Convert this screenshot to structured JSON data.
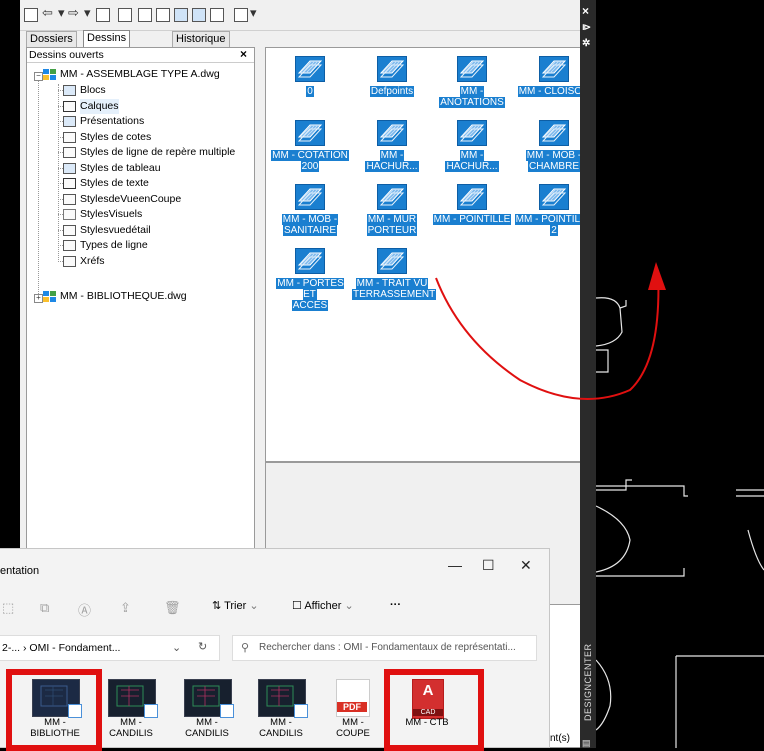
{
  "design_center": {
    "tabs": [
      "Dossiers",
      "Dessins ouverts",
      "Historique"
    ],
    "active_tab": "Dessins ouverts",
    "tree": {
      "header": "Dessins ouverts",
      "drawing1": "MM - ASSEMBLAGE TYPE A.dwg",
      "children": [
        {
          "label": "Blocs",
          "icon": "blocks-icon"
        },
        {
          "label": "Calques",
          "icon": "layers-icon"
        },
        {
          "label": "Présentations",
          "icon": "layouts-icon"
        },
        {
          "label": "Styles de cotes",
          "icon": "dimstyle-icon"
        },
        {
          "label": "Styles de ligne de repère multiple",
          "icon": "mleader-icon"
        },
        {
          "label": "Styles de tableau",
          "icon": "tablestyle-icon"
        },
        {
          "label": "Styles de texte",
          "icon": "textstyle-icon"
        },
        {
          "label": "StylesdeVueenCoupe",
          "icon": "sectionview-icon"
        },
        {
          "label": "StylesVisuels",
          "icon": "visualstyle-icon"
        },
        {
          "label": "Stylesvuedétail",
          "icon": "detailview-icon"
        },
        {
          "label": "Types de ligne",
          "icon": "linetype-icon"
        },
        {
          "label": "Xréfs",
          "icon": "xref-icon"
        }
      ],
      "drawing2": "MM - BIBLIOTHEQUE.dwg"
    },
    "layers": [
      {
        "l1": "0",
        "l2": ""
      },
      {
        "l1": "Defpoints",
        "l2": ""
      },
      {
        "l1": "MM -",
        "l2": "ANOTATIONS"
      },
      {
        "l1": "MM - CLOISON",
        "l2": ""
      },
      {
        "l1": "MM - COTATION",
        "l2": "200"
      },
      {
        "l1": "MM -",
        "l2": "HACHUR..."
      },
      {
        "l1": "MM -",
        "l2": "HACHUR..."
      },
      {
        "l1": "MM - MOB -",
        "l2": "CHAMBRE"
      },
      {
        "l1": "MM - MOB -",
        "l2": "SANITAIRE"
      },
      {
        "l1": "MM - MUR",
        "l2": "PORTEUR"
      },
      {
        "l1": "MM - POINTILLE",
        "l2": ""
      },
      {
        "l1": "MM - POINTILLE",
        "l2": "2"
      },
      {
        "l1": "MM - PORTES ET",
        "l2": "ACCES"
      },
      {
        "l1": "MM - TRAIT VU",
        "l2": "TERRASSEMENT"
      }
    ],
    "sidebar_label": "DESIGNCENTER",
    "desc_fragment": "nt(s)",
    "close_x": "×"
  },
  "explorer": {
    "title": "entation",
    "toolbar": {
      "sort": "Trier",
      "view": "Afficher",
      "more": "···"
    },
    "breadcrumb": "2-... › OMI - Fondament...",
    "search_placeholder": "Rechercher dans : OMI - Fondamentaux de représentati...",
    "files": [
      {
        "l1": "MM -",
        "l2": "BIBLIOTHE"
      },
      {
        "l1": "MM -",
        "l2": "CANDILIS"
      },
      {
        "l1": "MM -",
        "l2": "CANDILIS"
      },
      {
        "l1": "MM -",
        "l2": "CANDILIS"
      },
      {
        "l1": "MM -",
        "l2": "COUPE"
      },
      {
        "l1": "MM - CTB",
        "l2": ""
      }
    ],
    "pdf_badge": "PDF",
    "cad_letter": "A",
    "cad_badge": "CAD",
    "min": "—",
    "max": "☐",
    "close": "✕"
  },
  "colors": {
    "selection": "#1a7fd0",
    "annotation_red": "#e01010",
    "cad_background": "#000000"
  }
}
